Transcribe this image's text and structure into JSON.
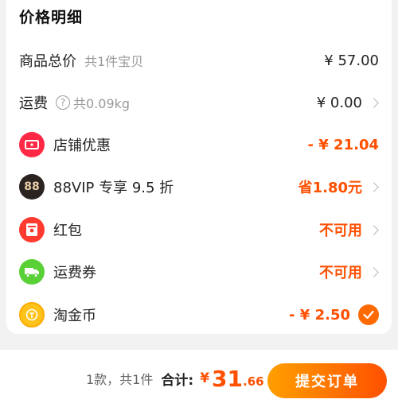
{
  "title": "价格明细",
  "rows": {
    "goods": {
      "label": "商品总价",
      "sub": "共1件宝贝",
      "value": "¥ 57.00"
    },
    "shipping": {
      "label": "运费",
      "help": "?",
      "sub": "共0.09kg",
      "value": "¥ 0.00"
    },
    "store_discount": {
      "label": "店铺优惠",
      "value": "- ¥ 21.04"
    },
    "vip": {
      "label": "88VIP 专享 9.5 折",
      "icon_text": "88",
      "value": "省1.80元"
    },
    "redpacket": {
      "label": "红包",
      "value": "不可用"
    },
    "shipping_coupon": {
      "label": "运费券",
      "value": "不可用"
    },
    "taojinbi": {
      "label": "淘金币",
      "value": "- ¥ 2.50"
    }
  },
  "footer": {
    "count": "1款，共1件",
    "total_label": "合计:",
    "currency": "¥",
    "amount_int": "31",
    "amount_dec": ".66",
    "submit_label": "提交订单"
  },
  "icons": {
    "store_discount": "coupon-icon",
    "vip": "vip-88-icon",
    "redpacket": "red-packet-icon",
    "shipping_coupon": "truck-icon",
    "taojinbi": "gold-coin-icon",
    "check": "check-icon"
  },
  "colors": {
    "accent": "#ff5000",
    "gradient_start": "#ff9f00"
  }
}
